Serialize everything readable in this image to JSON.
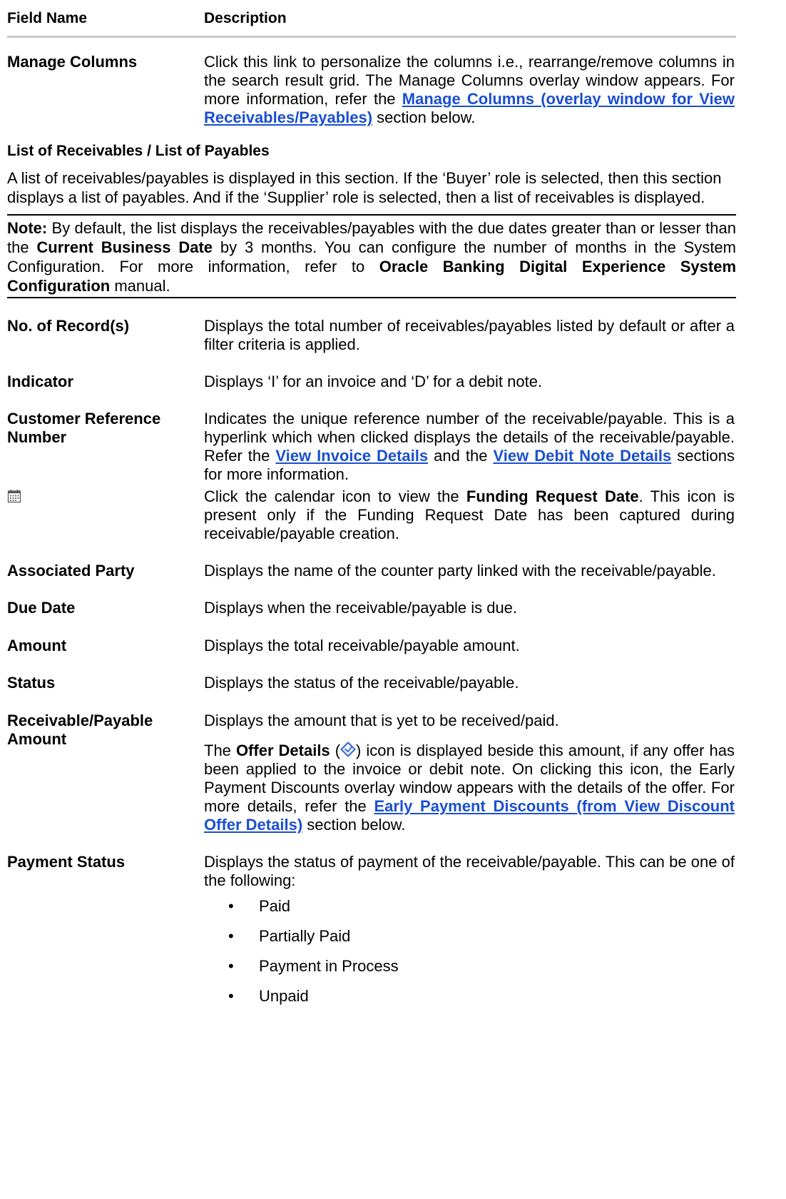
{
  "table_header": {
    "field_name": "Field Name",
    "description": "Description"
  },
  "manage_columns": {
    "name": "Manage Columns",
    "desc_pre": "Click this link to personalize the columns i.e., rearrange/remove columns in the search result grid. The Manage Columns overlay window appears. For more information, refer the ",
    "link": "Manage Columns (overlay window for View Receivables/Payables)",
    "desc_post": " section below."
  },
  "list_section": {
    "heading": "List of Receivables / List of Payables",
    "text": "A list of receivables/payables is displayed in this section. If the ‘Buyer’ role is selected, then this section displays a list of payables. And if the ‘Supplier’ role is selected, then a list of receivables is displayed."
  },
  "note": {
    "label": "Note:",
    "t1": " By default, the list displays the receivables/payables with the due dates greater than or lesser than the ",
    "b1": "Current Business Date",
    "t2": " by 3 months. You can configure the number of months in the System Configuration. For more information, refer to ",
    "b2": "Oracle Banking Digital Experience System Configuration",
    "t3": " manual."
  },
  "fields": {
    "records": {
      "name": "No. of Record(s)",
      "desc": "Displays the total number of receivables/payables listed by default or after a filter criteria is applied."
    },
    "indicator": {
      "name": "Indicator",
      "desc": "Displays ‘I’ for an invoice and ‘D’ for a debit note."
    },
    "customer_ref": {
      "name": "Customer Reference Number",
      "desc_pre": "Indicates the unique reference number of the receivable/payable. This is a hyperlink which when clicked displays the details of the receivable/payable. Refer the ",
      "link1": "View Invoice Details",
      "desc_mid": " and the ",
      "link2": "View Debit Note Details",
      "desc_post": " sections for more information."
    },
    "calendar": {
      "icon": "calendar-icon",
      "desc_pre": "Click the calendar icon to view the ",
      "bold": "Funding Request Date",
      "desc_post": ". This icon is present only if the Funding Request Date has been captured during receivable/payable creation."
    },
    "associated_party": {
      "name": "Associated Party",
      "desc": "Displays the name of the counter party linked with the receivable/payable."
    },
    "due_date": {
      "name": "Due Date",
      "desc": "Displays when the receivable/payable is due."
    },
    "amount": {
      "name": "Amount",
      "desc": "Displays the total receivable/payable amount."
    },
    "status": {
      "name": "Status",
      "desc": "Displays the status of the receivable/payable."
    },
    "receivable_amount": {
      "name": "Receivable/Payable Amount",
      "desc1": "Displays the amount that is yet to be received/paid.",
      "p2_pre": "The ",
      "p2_bold": "Offer Details",
      "p2_open": " (",
      "p2_close": ")",
      "p2_mid": " icon is displayed beside this amount, if any offer has been applied to the invoice or debit note. On clicking this icon, the Early Payment Discounts overlay window appears with the details of the offer. For more details, refer the ",
      "link": "Early Payment Discounts (from View Discount Offer Details)",
      "p2_post": " section below."
    },
    "payment_status": {
      "name": "Payment Status",
      "desc": "Displays the status of payment of the receivable/payable. This can be one of the following:",
      "bullet": "•",
      "options": [
        "Paid",
        "Partially Paid",
        "Payment in Process",
        "Unpaid"
      ]
    }
  },
  "colors": {
    "link": "#1a4fd0",
    "offer_icon": "#3b6fd6",
    "header_rule": "#c8c8c8"
  }
}
